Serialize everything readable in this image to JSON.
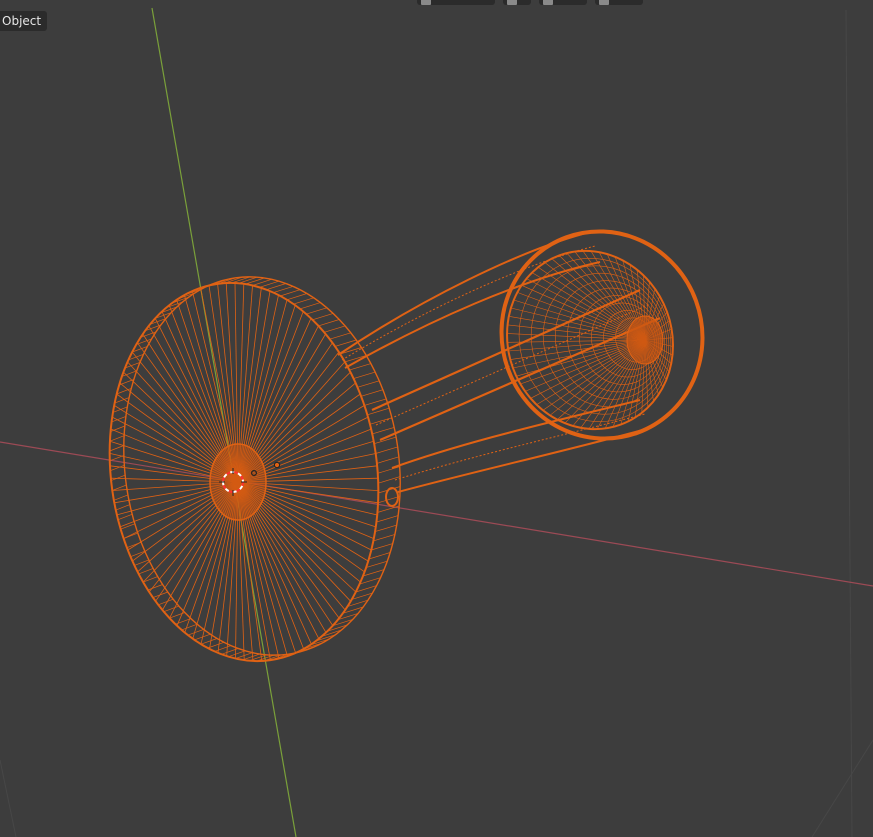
{
  "viewport": {
    "mode_label": "Object",
    "header_buttons": [
      {
        "name": "viewport-shading-button",
        "icon": "shading-icon"
      },
      {
        "name": "snap-button",
        "icon": "snap-icon"
      },
      {
        "name": "proportional-edit-button",
        "icon": "proportional-icon"
      },
      {
        "name": "overlay-button",
        "icon": "overlay-icon"
      }
    ]
  },
  "colors": {
    "background": "#3d3d3d",
    "wire_selected": "#e06214",
    "x_axis": "#9c4a55",
    "y_axis": "#7aa03a",
    "cursor_red": "#ff3030",
    "cursor_white": "#ffffff"
  }
}
